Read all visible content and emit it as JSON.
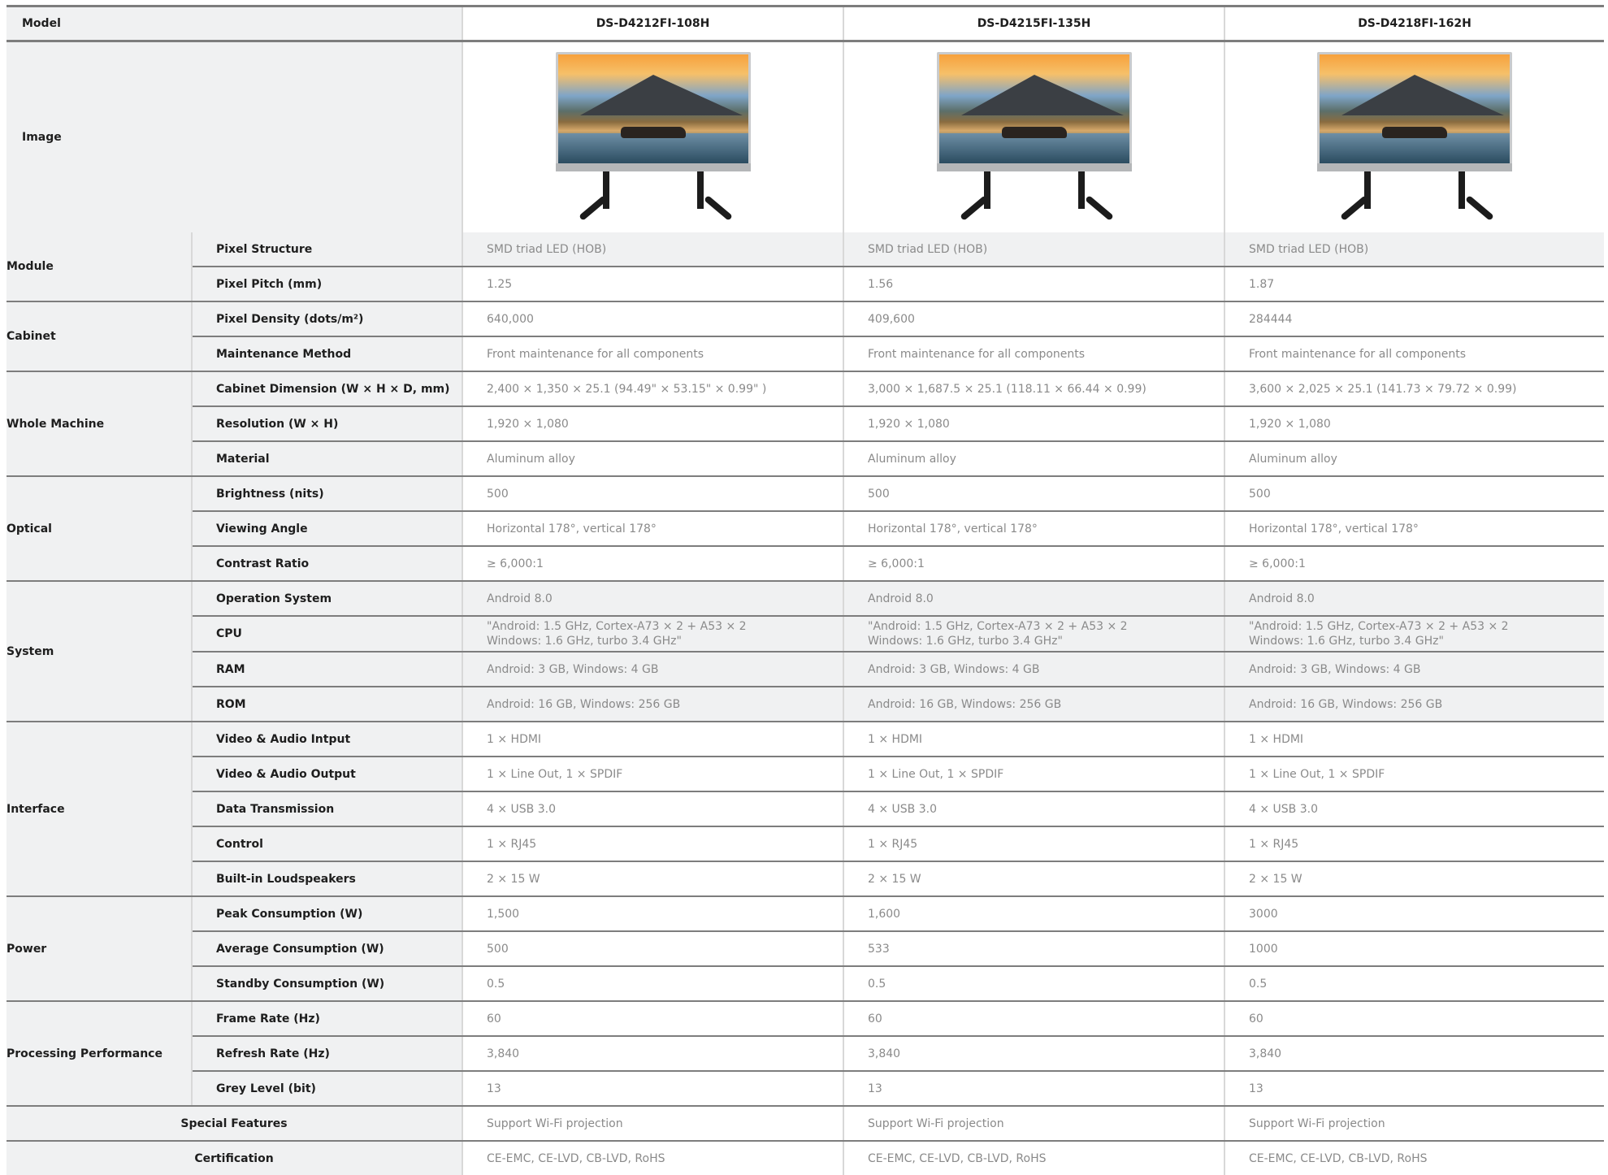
{
  "model_label": "Model",
  "models": [
    "DS-D4212FI-108H",
    "DS-D4215FI-135H",
    "DS-D4218FI-162H"
  ],
  "image_label": "Image",
  "groups": {
    "module": "Module",
    "cabinet": "Cabinet",
    "whole_machine": "Whole Machine",
    "optical": "Optical",
    "system": "System",
    "interface": "Interface",
    "power": "Power",
    "processing": "Processing Performance"
  },
  "rows": [
    {
      "label": "Pixel Structure",
      "values": [
        "SMD triad LED (HOB)",
        "SMD triad LED (HOB)",
        "SMD triad LED (HOB)"
      ]
    },
    {
      "label": "Pixel Pitch (mm)",
      "values": [
        "1.25",
        "1.56",
        "1.87"
      ]
    },
    {
      "label": "Pixel Density (dots/m²)",
      "values": [
        "640,000",
        "409,600",
        "284444"
      ]
    },
    {
      "label": "Maintenance Method",
      "values": [
        "Front maintenance for all components",
        "Front maintenance for all components",
        "Front maintenance for all components"
      ]
    },
    {
      "label": "Cabinet Dimension (W × H × D, mm)",
      "values": [
        "2,400 × 1,350 × 25.1 (94.49\" × 53.15\" × 0.99\" )",
        "3,000 × 1,687.5 × 25.1 (118.11 × 66.44 × 0.99)",
        "3,600 × 2,025 × 25.1 (141.73 × 79.72 × 0.99)"
      ]
    },
    {
      "label": "Resolution (W × H)",
      "values": [
        "1,920 × 1,080",
        "1,920 × 1,080",
        "1,920 × 1,080"
      ]
    },
    {
      "label": "Material",
      "values": [
        "Aluminum alloy",
        "Aluminum alloy",
        "Aluminum alloy"
      ]
    },
    {
      "label": "Brightness (nits)",
      "values": [
        "500",
        "500",
        "500"
      ]
    },
    {
      "label": "Viewing Angle",
      "values": [
        "Horizontal 178°, vertical 178°",
        "Horizontal 178°, vertical 178°",
        "Horizontal 178°, vertical 178°"
      ]
    },
    {
      "label": "Contrast Ratio",
      "values": [
        "≥ 6,000:1",
        "≥ 6,000:1",
        "≥ 6,000:1"
      ]
    },
    {
      "label": "Operation System",
      "values": [
        "Android 8.0",
        "Android 8.0",
        "Android 8.0"
      ]
    },
    {
      "label": "CPU",
      "values": [
        "\"Android: 1.5 GHz, Cortex-A73 × 2 + A53 × 2\nWindows: 1.6 GHz, turbo 3.4 GHz\"",
        "\"Android: 1.5 GHz, Cortex-A73 × 2 + A53 × 2\nWindows: 1.6 GHz, turbo 3.4 GHz\"",
        "\"Android: 1.5 GHz, Cortex-A73 × 2 + A53 × 2\nWindows: 1.6 GHz, turbo 3.4 GHz\""
      ]
    },
    {
      "label": "RAM",
      "values": [
        "Android: 3 GB, Windows: 4 GB",
        "Android: 3 GB, Windows: 4 GB",
        "Android: 3 GB, Windows: 4 GB"
      ]
    },
    {
      "label": "ROM",
      "values": [
        "Android: 16 GB, Windows: 256 GB",
        "Android: 16 GB, Windows: 256 GB",
        "Android: 16 GB, Windows: 256 GB"
      ]
    },
    {
      "label": "Video & Audio Intput",
      "values": [
        "1 × HDMI",
        "1 × HDMI",
        "1 × HDMI"
      ]
    },
    {
      "label": "Video & Audio Output",
      "values": [
        "1 × Line Out, 1 × SPDIF",
        "1 × Line Out, 1 × SPDIF",
        "1 × Line Out, 1 × SPDIF"
      ]
    },
    {
      "label": "Data Transmission",
      "values": [
        "4 × USB 3.0",
        "4 × USB 3.0",
        "4 × USB 3.0"
      ]
    },
    {
      "label": "Control",
      "values": [
        "1 × RJ45",
        "1 × RJ45",
        "1 × RJ45"
      ]
    },
    {
      "label": "Built-in Loudspeakers",
      "values": [
        "2 × 15 W",
        "2 × 15 W",
        "2 × 15 W"
      ]
    },
    {
      "label": "Peak Consumption (W)",
      "values": [
        "1,500",
        "1,600",
        "3000"
      ]
    },
    {
      "label": "Average Consumption (W)",
      "values": [
        "500",
        "533",
        "1000"
      ]
    },
    {
      "label": "Standby Consumption (W)",
      "values": [
        "0.5",
        "0.5",
        "0.5"
      ]
    },
    {
      "label": "Frame Rate (Hz)",
      "values": [
        "60",
        "60",
        "60"
      ]
    },
    {
      "label": "Refresh Rate (Hz)",
      "values": [
        "3,840",
        "3,840",
        "3,840"
      ]
    },
    {
      "label": "Grey Level (bit)",
      "values": [
        "13",
        "13",
        "13"
      ]
    }
  ],
  "special_features": {
    "label": "Special Features",
    "values": [
      "Support Wi-Fi projection",
      "Support Wi-Fi projection",
      "Support Wi-Fi projection"
    ]
  },
  "certification": {
    "label": "Certification",
    "values": [
      "CE-EMC, CE-LVD, CB-LVD, RoHS",
      "CE-EMC, CE-LVD, CB-LVD, RoHS",
      "CE-EMC, CE-LVD, CB-LVD, RoHS"
    ]
  },
  "colors": {
    "label_bg": "#f0f1f2",
    "rule": "#7d7d7d",
    "value_text": "#8a8a8a",
    "label_text": "#1e1e1e"
  },
  "icons": {
    "product_image": "led-display-on-stand-icon"
  }
}
